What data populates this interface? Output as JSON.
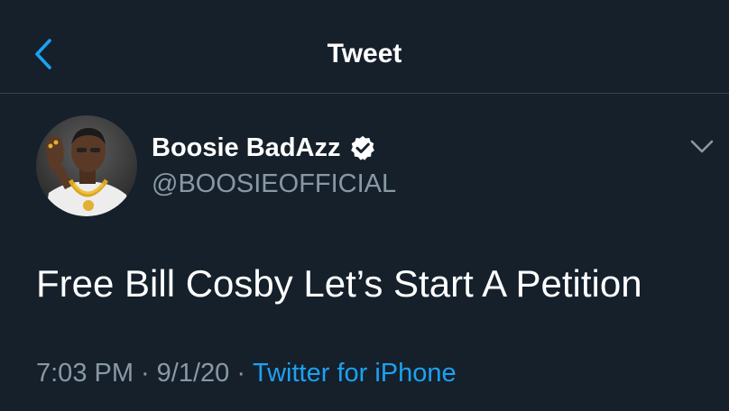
{
  "header": {
    "title": "Tweet",
    "back_icon": "chevron-left-icon"
  },
  "tweet": {
    "author": {
      "display_name": "Boosie BadAzz",
      "handle": "@BOOSIEOFFICIAL",
      "verified": true,
      "verified_icon": "verified-badge-icon"
    },
    "menu_icon": "chevron-down-icon",
    "text": "Free Bill Cosby Let’s Start A Petition",
    "time": "7:03 PM",
    "separator": "·",
    "date": "9/1/20",
    "source": "Twitter for iPhone"
  },
  "colors": {
    "background": "#15202b",
    "divider": "#38444d",
    "accent": "#1da1f2",
    "secondary_text": "#8899a6",
    "primary_text": "#ffffff"
  }
}
